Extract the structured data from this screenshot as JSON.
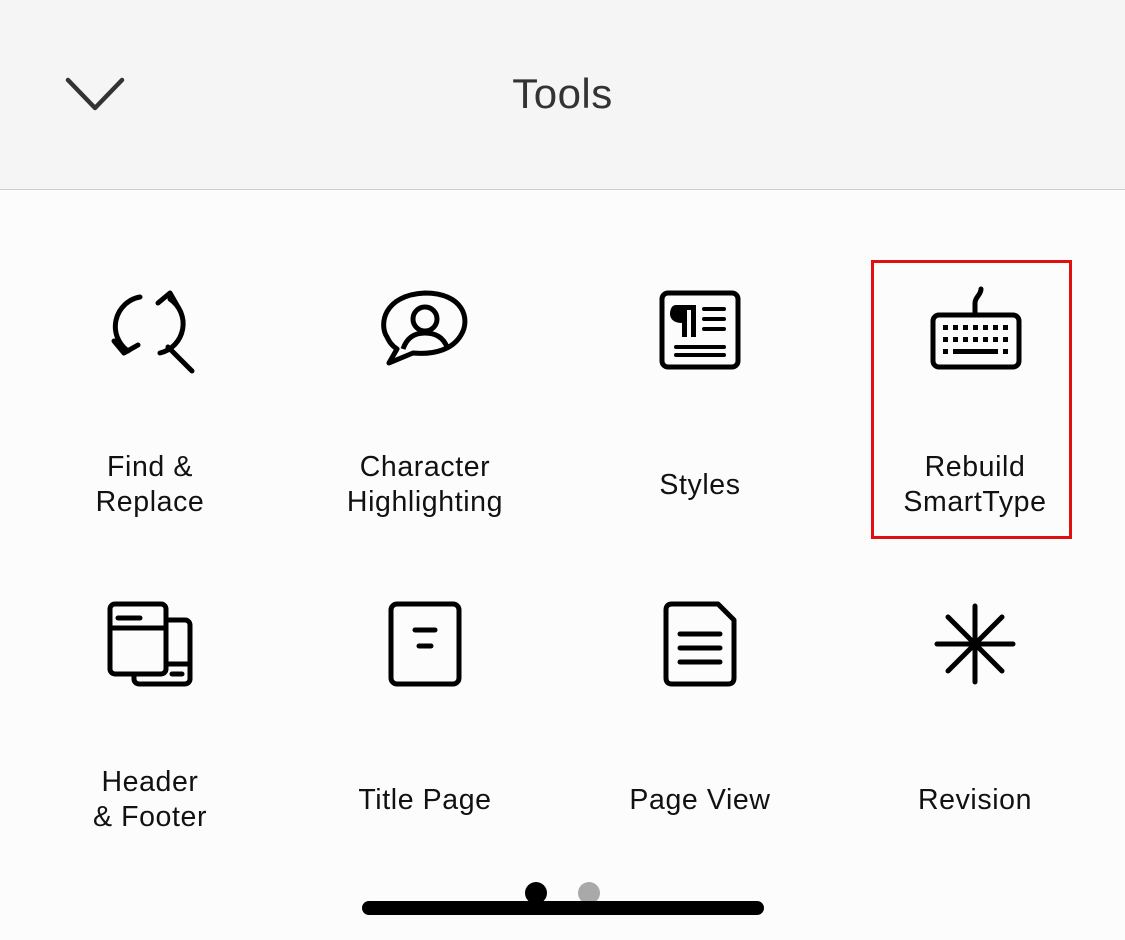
{
  "header": {
    "title": "Tools",
    "collapse_icon": "chevron-down-icon"
  },
  "tools": [
    {
      "label": "Find &\nReplace",
      "icon": "find-replace-icon"
    },
    {
      "label": "Character\nHighlighting",
      "icon": "character-highlight-icon"
    },
    {
      "label": "Styles",
      "icon": "styles-icon"
    },
    {
      "label": "Rebuild\nSmartType",
      "icon": "keyboard-icon",
      "highlighted": true
    },
    {
      "label": "Header\n& Footer",
      "icon": "header-footer-icon"
    },
    {
      "label": "Title Page",
      "icon": "title-page-icon"
    },
    {
      "label": "Page View",
      "icon": "page-view-icon"
    },
    {
      "label": "Revision",
      "icon": "asterisk-icon"
    }
  ],
  "pagination": {
    "current": 1,
    "total": 2
  },
  "colors": {
    "highlight": "#e01010",
    "header_bg": "#f5f5f5",
    "dot_active": "#000000",
    "dot_inactive": "#a9a9a9"
  }
}
